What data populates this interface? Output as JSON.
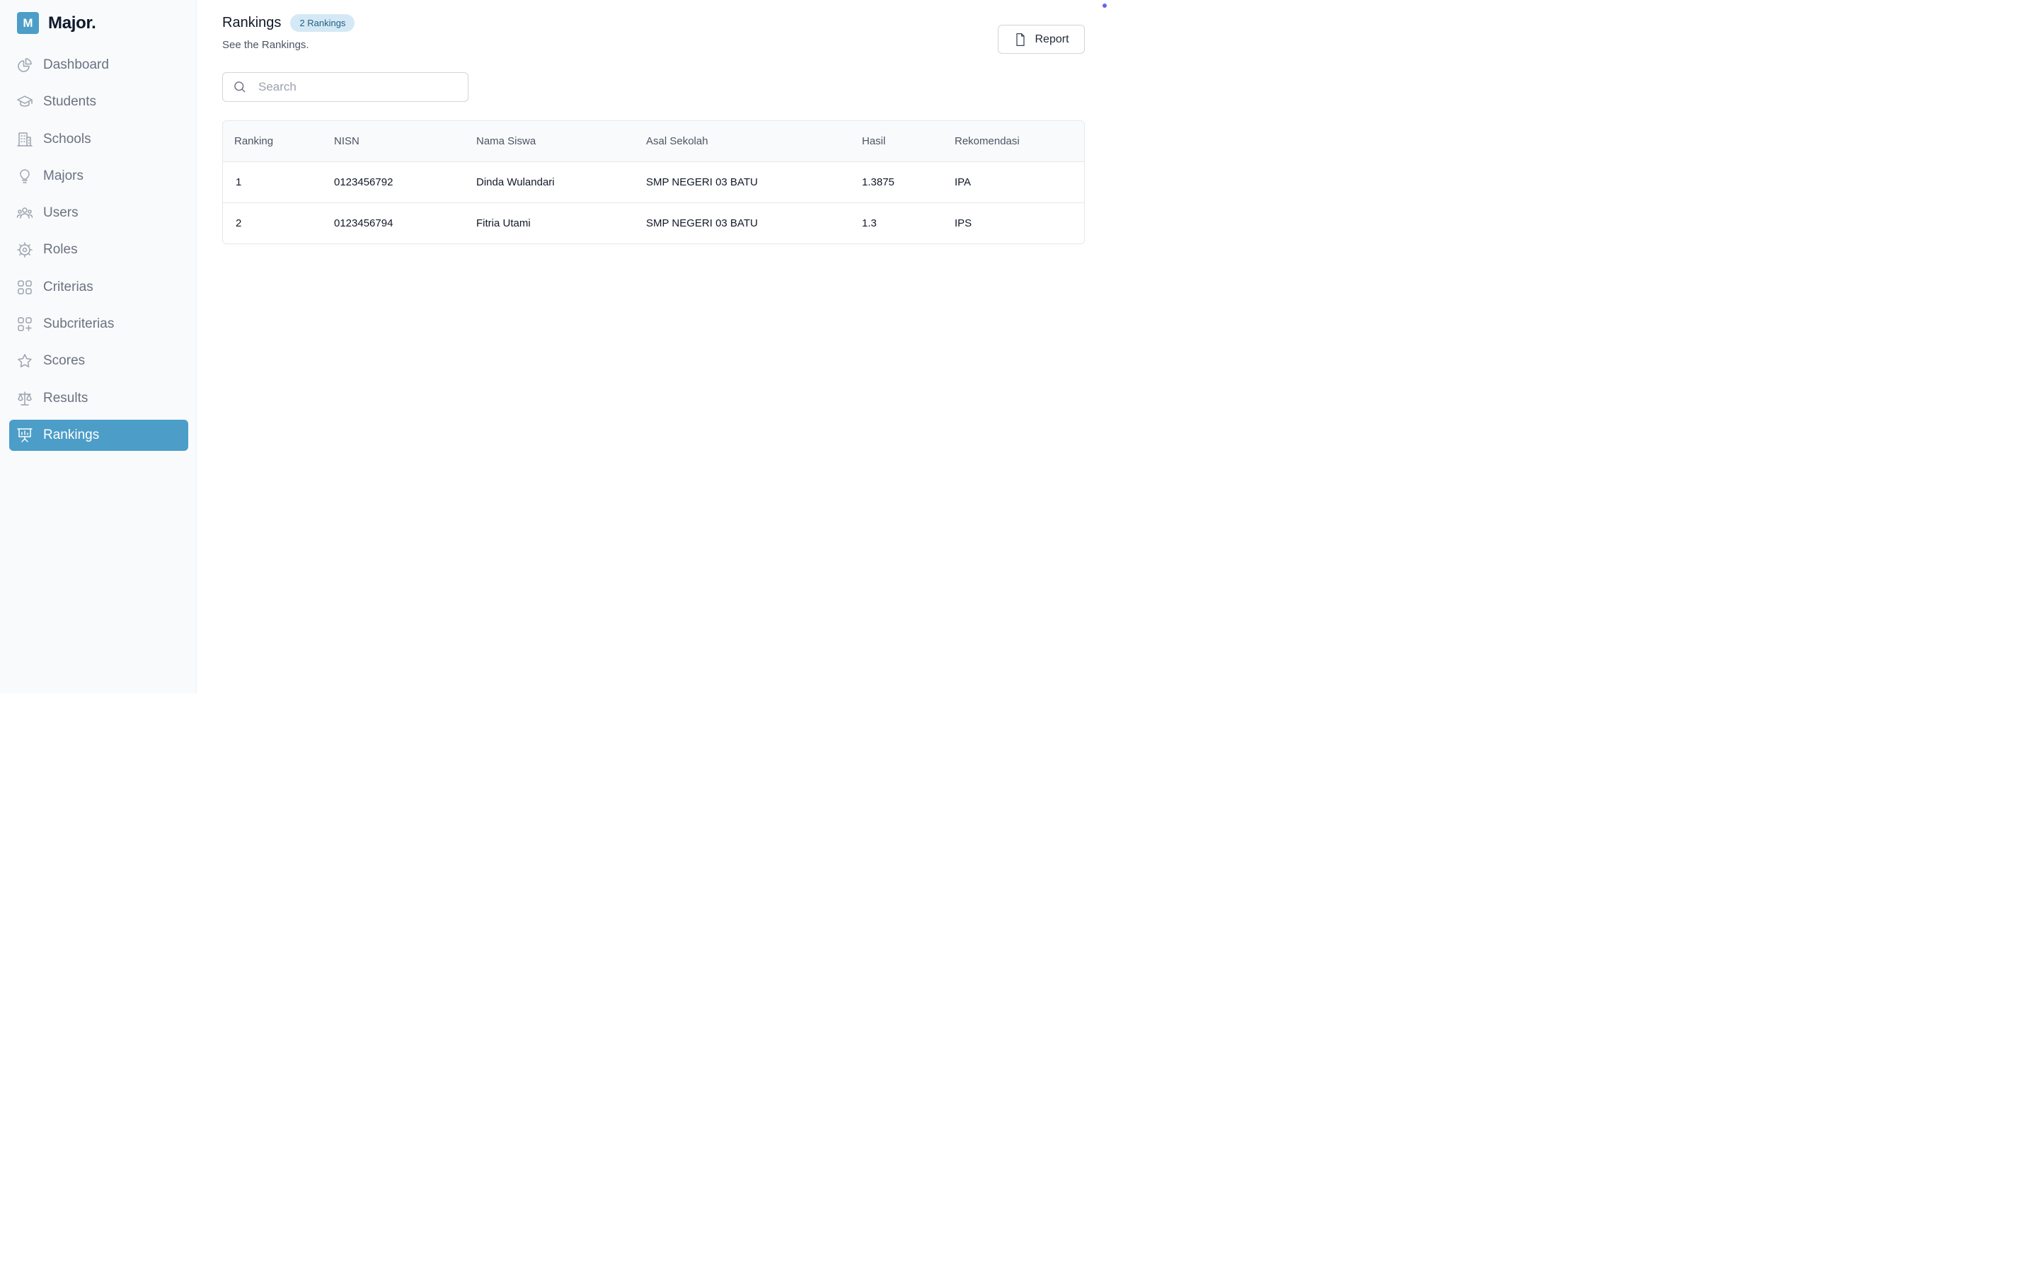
{
  "brand": {
    "logo_letter": "M",
    "name": "Major."
  },
  "sidebar": {
    "items": [
      {
        "label": "Dashboard",
        "icon": "chart-pie-icon"
      },
      {
        "label": "Students",
        "icon": "academic-cap-icon"
      },
      {
        "label": "Schools",
        "icon": "building-icon"
      },
      {
        "label": "Majors",
        "icon": "light-bulb-icon"
      },
      {
        "label": "Users",
        "icon": "user-group-icon"
      },
      {
        "label": "Roles",
        "icon": "cog-icon"
      },
      {
        "label": "Criterias",
        "icon": "squares-icon"
      },
      {
        "label": "Subcriterias",
        "icon": "squares-plus-icon"
      },
      {
        "label": "Scores",
        "icon": "star-icon"
      },
      {
        "label": "Results",
        "icon": "scale-icon"
      },
      {
        "label": "Rankings",
        "icon": "presentation-chart-icon",
        "active": true
      }
    ]
  },
  "header": {
    "title": "Rankings",
    "badge": "2 Rankings",
    "subtitle": "See the Rankings.",
    "report_label": "Report"
  },
  "search": {
    "placeholder": "Search",
    "value": ""
  },
  "table": {
    "columns": [
      "Ranking",
      "NISN",
      "Nama Siswa",
      "Asal Sekolah",
      "Hasil",
      "Rekomendasi"
    ],
    "rows": [
      [
        "1",
        "0123456792",
        "Dinda Wulandari",
        "SMP NEGERI 03 BATU",
        "1.3875",
        "IPA"
      ],
      [
        "2",
        "0123456794",
        "Fitria Utami",
        "SMP NEGERI 03 BATU",
        "1.3",
        "IPS"
      ]
    ]
  },
  "colors": {
    "accent": "#4c9dc7",
    "badge_bg": "#d4e9f5",
    "sidebar_bg": "#f8fafc"
  }
}
